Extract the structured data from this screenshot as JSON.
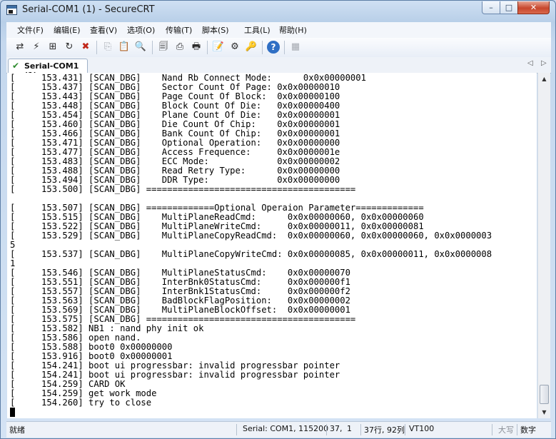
{
  "window": {
    "title": "Serial-COM1 (1) - SecureCRT",
    "min": "–",
    "max": "□",
    "close": "✕"
  },
  "menu": [
    {
      "id": "file",
      "label": "文件(F)"
    },
    {
      "id": "edit",
      "label": "编辑(E)"
    },
    {
      "id": "view",
      "label": "查看(V)"
    },
    {
      "id": "options",
      "label": "选项(O)"
    },
    {
      "id": "transfer",
      "label": "传输(T)"
    },
    {
      "id": "script",
      "label": "脚本(S)"
    },
    {
      "id": "tools",
      "label": "工具(L)"
    },
    {
      "id": "help",
      "label": "帮助(H)"
    }
  ],
  "toolbar": {
    "icons": [
      {
        "name": "connect-icon",
        "glyph": "⇄",
        "dim": false
      },
      {
        "name": "quick-connect-icon",
        "glyph": "⚡",
        "dim": false
      },
      {
        "name": "connect-tab-icon",
        "glyph": "⊞",
        "dim": false
      },
      {
        "name": "reconnect-icon",
        "glyph": "↻",
        "dim": false
      },
      {
        "name": "disconnect-icon",
        "glyph": "✖",
        "dim": false
      },
      {
        "name": "copy-icon",
        "glyph": "⎘",
        "dim": true
      },
      {
        "name": "paste-icon",
        "glyph": "📋",
        "dim": false
      },
      {
        "name": "find-icon",
        "glyph": "🔍",
        "dim": false
      },
      {
        "name": "print-setup-icon",
        "glyph": "🗐",
        "dim": false
      },
      {
        "name": "print-selection-icon",
        "glyph": "⎙",
        "dim": false
      },
      {
        "name": "print-icon",
        "glyph": "🖶",
        "dim": false
      },
      {
        "name": "session-options-icon",
        "glyph": "📝",
        "dim": false
      },
      {
        "name": "global-options-icon",
        "glyph": "⚙",
        "dim": false
      },
      {
        "name": "keymap-icon",
        "glyph": "🔑",
        "dim": false
      },
      {
        "name": "help-icon",
        "glyph": "?",
        "dim": false
      },
      {
        "name": "map-keys-icon",
        "glyph": "▦",
        "dim": true
      }
    ]
  },
  "tabs": [
    {
      "label": "Serial-COM1 (1)",
      "check": "✔",
      "active": true
    }
  ],
  "tab_nav": {
    "prev": "◁",
    "next": "▷"
  },
  "terminal": {
    "lines": [
      "[     153.431] [SCAN_DBG]    Nand Rb Connect Mode:      0x0x00000001",
      "[     153.437] [SCAN_DBG]    Sector Count Of Page: 0x0x00000010",
      "[     153.443] [SCAN_DBG]    Page Count Of Block:  0x0x00000100",
      "[     153.448] [SCAN_DBG]    Block Count Of Die:   0x0x00000400",
      "[     153.454] [SCAN_DBG]    Plane Count Of Die:   0x0x00000001",
      "[     153.460] [SCAN_DBG]    Die Count Of Chip:    0x0x00000001",
      "[     153.466] [SCAN_DBG]    Bank Count Of Chip:   0x0x00000001",
      "[     153.471] [SCAN_DBG]    Optional Operation:   0x0x00000000",
      "[     153.477] [SCAN_DBG]    Access Frequence:     0x0x0000001e",
      "[     153.483] [SCAN_DBG]    ECC Mode:             0x0x00000002",
      "[     153.488] [SCAN_DBG]    Read Retry Type:      0x0x00000000",
      "[     153.494] [SCAN_DBG]    DDR Type:             0x0x00000000",
      "[     153.500] [SCAN_DBG] ========================================",
      "",
      "[     153.507] [SCAN_DBG] =============Optional Operaion Parameter=============",
      "[     153.515] [SCAN_DBG]    MultiPlaneReadCmd:      0x0x00000060, 0x0x00000060",
      "[     153.522] [SCAN_DBG]    MultiPlaneWriteCmd:     0x0x00000011, 0x0x00000081",
      "[     153.529] [SCAN_DBG]    MultiPlaneCopyReadCmd:  0x0x00000060, 0x0x00000060, 0x0x0000003",
      "5",
      "[     153.537] [SCAN_DBG]    MultiPlaneCopyWriteCmd: 0x0x00000085, 0x0x00000011, 0x0x0000008",
      "1",
      "[     153.546] [SCAN_DBG]    MultiPlaneStatusCmd:    0x0x00000070",
      "[     153.551] [SCAN_DBG]    InterBnk0StatusCmd:     0x0x000000f1",
      "[     153.557] [SCAN_DBG]    InterBnk1StatusCmd:     0x0x000000f2",
      "[     153.563] [SCAN_DBG]    BadBlockFlagPosition:   0x0x00000002",
      "[     153.569] [SCAN_DBG]    MultiPlaneBlockOffset:  0x0x00000001",
      "[     153.575] [SCAN_DBG] ========================================",
      "[     153.582] NB1 : nand phy init ok",
      "[     153.586] open nand.",
      "[     153.588] boot0 0x00000000",
      "[     153.916] boot0 0x00000001",
      "[     154.241] boot ui progressbar: invalid progressbar pointer",
      "[     154.241] boot ui progressbar: invalid progressbar pointer",
      "[     154.259] CARD OK",
      "[     154.259] get work mode",
      "[     154.260] try to close"
    ]
  },
  "scrollbar": {
    "up": "▲",
    "down": "▼"
  },
  "status": {
    "ready": "就绪",
    "connection": "Serial: COM1, 115200",
    "row": "37,",
    "col": "1",
    "size": "37行, 92列",
    "emulation": "VT100",
    "caps": "大写",
    "num": "数字"
  }
}
